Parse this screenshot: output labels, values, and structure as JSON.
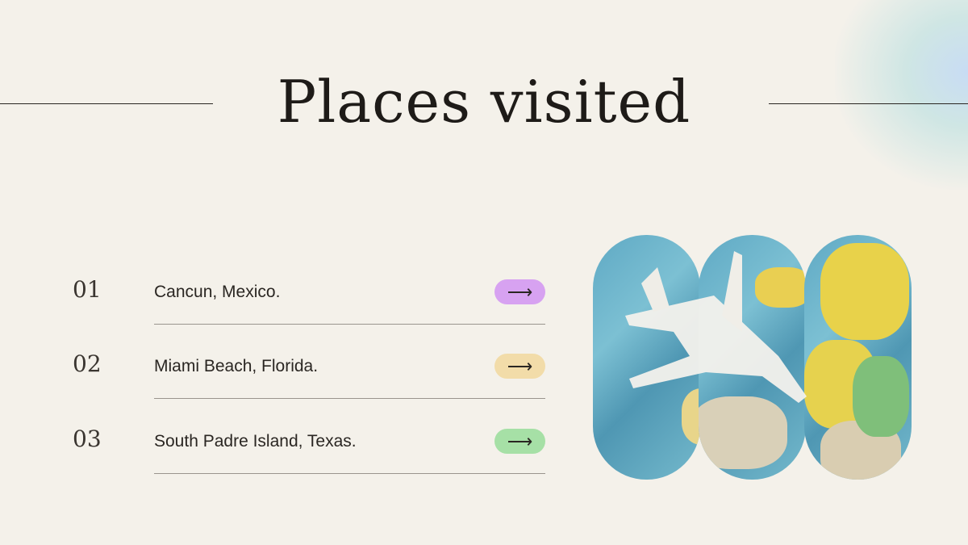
{
  "title": "Places visited",
  "items": [
    {
      "number": "01",
      "place": "Cancun, Mexico.",
      "arrow": "⟶",
      "color": "#d7a2f1"
    },
    {
      "number": "02",
      "place": "Miami Beach, Florida.",
      "arrow": "⟶",
      "color": "#f2dca9"
    },
    {
      "number": "03",
      "place": "South Padre Island, Texas.",
      "arrow": "⟶",
      "color": "#a6e0a6"
    }
  ],
  "image": {
    "subject": "toy airplane on globe"
  }
}
